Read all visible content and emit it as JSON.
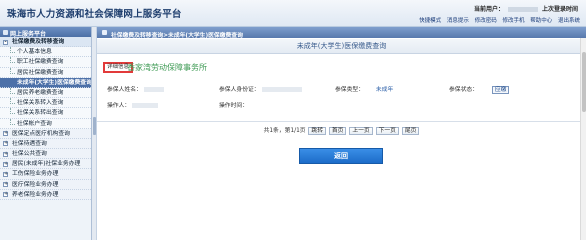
{
  "header": {
    "site_title": "珠海市人力资源和社会保障网上服务平台",
    "current_user_label": "当前用户：",
    "last_login_label": "上次登录时间",
    "links": [
      "快捷模式",
      "消息提示",
      "修改密码",
      "修改手机",
      "帮助中心",
      "退出系统"
    ]
  },
  "sidebar": {
    "platform_label": "网上服务平台",
    "items": [
      {
        "label": "社保缴费及转移查询",
        "kind": "group",
        "toggle": "-"
      },
      {
        "label": "个人基本信息",
        "kind": "sub"
      },
      {
        "label": "职工社保缴费查询",
        "kind": "sub"
      },
      {
        "label": "居民社保缴费查询",
        "kind": "sub"
      },
      {
        "label": "未成年(大学生)医保缴费查询",
        "kind": "active"
      },
      {
        "label": "居民养老缴费查询",
        "kind": "sub"
      },
      {
        "label": "社保关系转入查询",
        "kind": "sub"
      },
      {
        "label": "社保关系转出查询",
        "kind": "sub"
      },
      {
        "label": "社保帐户查询",
        "kind": "sub"
      },
      {
        "label": "医保定点医疗机构查询",
        "kind": "top",
        "toggle": "+"
      },
      {
        "label": "社保待遇查询",
        "kind": "top",
        "toggle": "+"
      },
      {
        "label": "社保公共查询",
        "kind": "top",
        "toggle": "+"
      },
      {
        "label": "居民(未成年)社保业务办理",
        "kind": "top",
        "toggle": "+"
      },
      {
        "label": "工伤保险业务办理",
        "kind": "top",
        "toggle": "+"
      },
      {
        "label": "医疗保险业务办理",
        "kind": "top",
        "toggle": "+"
      },
      {
        "label": "养老保险业务办理",
        "kind": "top",
        "toggle": "+"
      }
    ]
  },
  "breadcrumb": "社保缴费及转移查询>未成年(大学生)医保缴费查询",
  "panel": {
    "title": "未成年(大学生)医保缴费查询",
    "detail_button": "详细信息",
    "org_name": "香家湾劳动保障事务所",
    "fields": {
      "insured_name_label": "参保人姓名：",
      "id_number_label": "参保人身份证：",
      "insurance_type_label": "参保类型：",
      "insurance_type_value": "未成年",
      "status_label": "参保状态：",
      "status_value": "应缴",
      "operator_label": "操作人：",
      "operate_time_label": "操作时间："
    },
    "pager": {
      "summary": "共1条，第1/1页",
      "jump_label": "跳转",
      "first": "首页",
      "prev": "上一页",
      "next": "下一页",
      "last": "尾页"
    },
    "back_button": "返回"
  }
}
